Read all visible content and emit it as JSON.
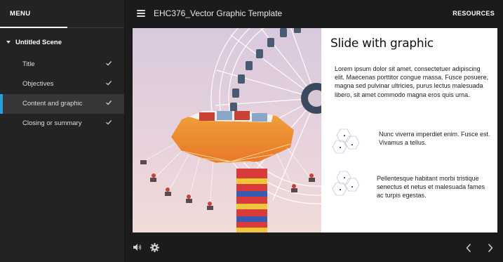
{
  "sidebar": {
    "menu_title": "MENU",
    "scene_title": "Untitled Scene",
    "items": [
      {
        "label": "Title",
        "completed": true,
        "active": false
      },
      {
        "label": "Objectives",
        "completed": true,
        "active": false
      },
      {
        "label": "Content and graphic",
        "completed": true,
        "active": true
      },
      {
        "label": "Closing or summary",
        "completed": true,
        "active": false
      }
    ]
  },
  "topbar": {
    "menu_icon": "hamburger-icon",
    "course_title": "EHC376_Vector Graphic Template",
    "resources_label": "RESOURCES"
  },
  "slide": {
    "title": "Slide with graphic",
    "paragraph": "Lorem ipsum dolor sit amet, consectetuer adipiscing elit. Maecenas porttitor congue massa. Fusce posuere, magna sed pulvinar ultricies, purus lectus malesuada libero, sit amet commodo magna eros quis urna.",
    "bullets": [
      {
        "text": "Nunc viverra imperdiet enim. Fusce est. Vivamus a tellus.",
        "icon": "hexagon-network-icon"
      },
      {
        "text": "Pellentesque habitant morbi tristique senectus et netus et malesuada fames ac turpis egestas.",
        "icon": "hexagon-network-icon"
      }
    ],
    "photo": "ferris-wheel-and-swing-carousel-photo"
  },
  "controls": {
    "volume_icon": "volume-icon",
    "settings_icon": "gear-icon",
    "prev_icon": "chevron-left-icon",
    "next_icon": "chevron-right-icon"
  },
  "colors": {
    "accent": "#2a9fd8",
    "background": "#1b1b1b",
    "sidebar": "#232323",
    "active_item": "#363636"
  }
}
